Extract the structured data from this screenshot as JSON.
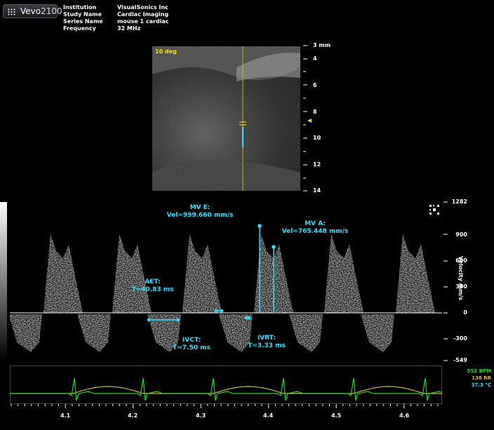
{
  "app": {
    "brand_prefix": "Vevo",
    "brand_suffix": "2100"
  },
  "info": [
    {
      "label": "Institution",
      "value": "VisualSonics Inc"
    },
    {
      "label": "Study Name",
      "value": "Cardiac Imaging"
    },
    {
      "label": "Series Name",
      "value": "mouse 1 cardiac"
    },
    {
      "label": "Frequency",
      "value": "32 MHz"
    }
  ],
  "bmode": {
    "angle": "10 deg",
    "depth_ticks": [
      "3 mm",
      "4",
      "6",
      "8",
      "10",
      "12",
      "14"
    ]
  },
  "measurements": {
    "mv_e": {
      "name": "MV E:",
      "value": "Vel=999.660 mm/s"
    },
    "mv_a": {
      "name": "MV A:",
      "value": "Vel=765.448 mm/s"
    },
    "aet": {
      "name": "AET:",
      "value": "T=40.83 ms"
    },
    "ivct": {
      "name": "IVCT:",
      "value": "T=7.50 ms"
    },
    "ivrt": {
      "name": "IVRT:",
      "value": "T=3.33 ms"
    }
  },
  "velocity_axis": {
    "title": "Velocity mm/s",
    "ticks": [
      "1282",
      "900",
      "600",
      "300",
      "0",
      "-300",
      "-549"
    ]
  },
  "physio": {
    "heart_rate": "552 BPM",
    "resp_rate": "138 RR",
    "temp": "37.3 °C"
  },
  "time_axis": {
    "ticks": [
      "4.1",
      "4.2",
      "4.3",
      "4.4",
      "4.5",
      "4.6"
    ]
  },
  "colors": {
    "cyan": "#2ee0ff",
    "ecg": "#2fd12f",
    "resp": "#d8b83a",
    "yellow": "#ffe000"
  }
}
